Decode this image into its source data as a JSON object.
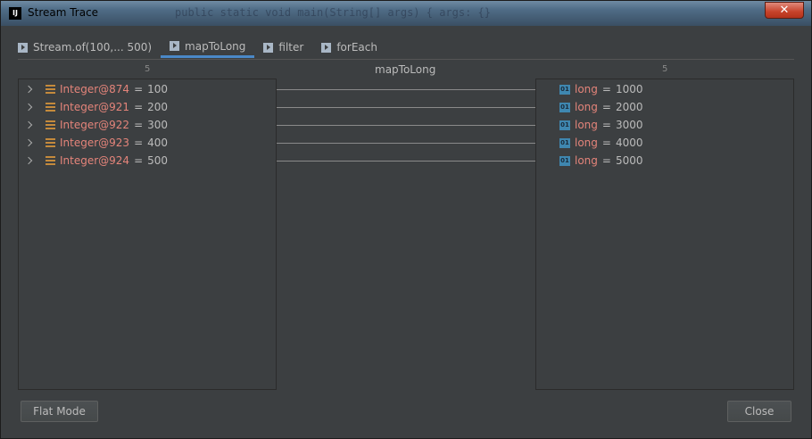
{
  "window": {
    "title": "Stream Trace",
    "app_icon": "IJ",
    "close_glyph": "✕",
    "background_code": "public static void main(String[] args) {   args: {}"
  },
  "tabs": [
    {
      "label": "Stream.of(100,... 500)",
      "active": false,
      "icon": "play-icon"
    },
    {
      "label": "mapToLong",
      "active": true,
      "icon": "play-icon"
    },
    {
      "label": "filter",
      "active": false,
      "icon": "play-icon"
    },
    {
      "label": "forEach",
      "active": false,
      "icon": "play-icon"
    }
  ],
  "left_panel": {
    "count": "5",
    "items": [
      {
        "name": "Integer@874",
        "value": "100"
      },
      {
        "name": "Integer@921",
        "value": "200"
      },
      {
        "name": "Integer@922",
        "value": "300"
      },
      {
        "name": "Integer@923",
        "value": "400"
      },
      {
        "name": "Integer@924",
        "value": "500"
      }
    ]
  },
  "center": {
    "title": "mapToLong"
  },
  "right_panel": {
    "count": "5",
    "icon_text": "01",
    "items": [
      {
        "name": "long",
        "value": "1000"
      },
      {
        "name": "long",
        "value": "2000"
      },
      {
        "name": "long",
        "value": "3000"
      },
      {
        "name": "long",
        "value": "4000"
      },
      {
        "name": "long",
        "value": "5000"
      }
    ]
  },
  "buttons": {
    "flat_mode": "Flat Mode",
    "close": "Close"
  },
  "colors": {
    "accent_tab": "#4a88c7",
    "name": "#e4847a",
    "list_icon": "#c48a3c",
    "prim_icon": "#3f87b0"
  }
}
